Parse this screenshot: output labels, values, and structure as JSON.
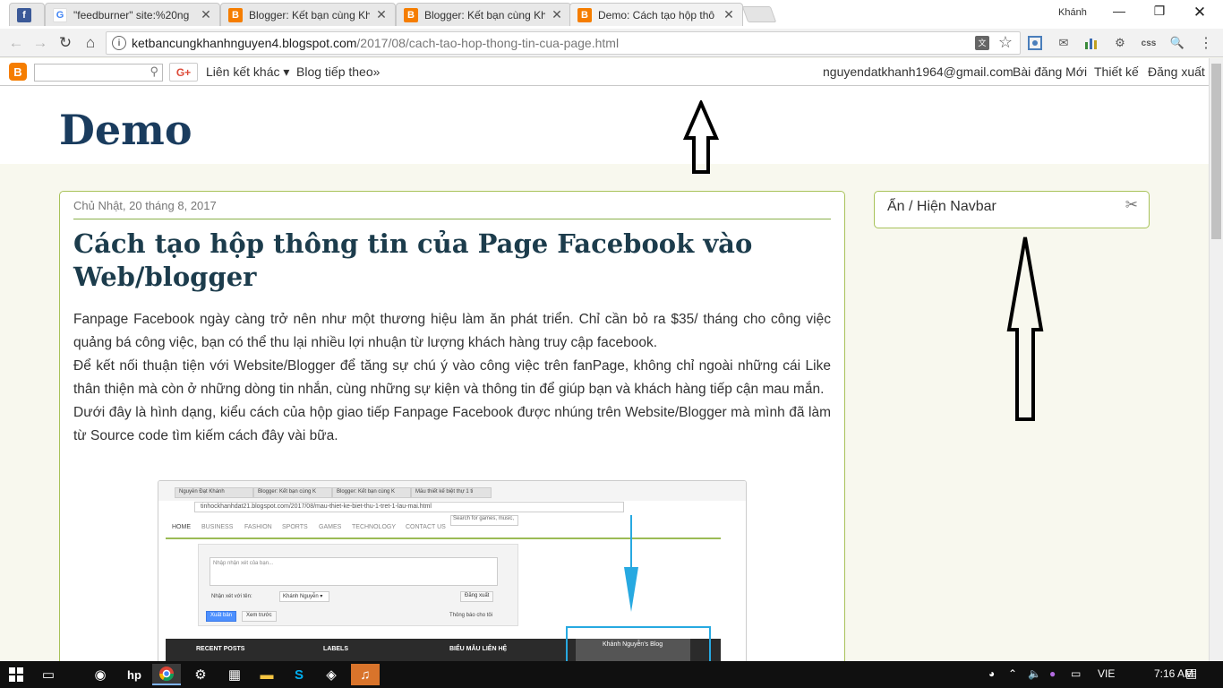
{
  "browser": {
    "tabs": [
      {
        "title": "",
        "favicon": "facebook-icon",
        "fav_color": "#3b5998",
        "active": false
      },
      {
        "title": "\"feedburner\" site:%20ng",
        "favicon": "google-icon",
        "fav_color": "#4285f4",
        "active": false
      },
      {
        "title": "Blogger: Kết bạn cùng Kh",
        "favicon": "blogger-icon",
        "fav_color": "#f57d00",
        "active": false
      },
      {
        "title": "Blogger: Kết bạn cùng Kh",
        "favicon": "blogger-icon",
        "fav_color": "#f57d00",
        "active": false
      },
      {
        "title": "Demo: Cách tạo hộp thô",
        "favicon": "blogger-icon",
        "fav_color": "#f57d00",
        "active": true
      }
    ],
    "user_label": "Khánh",
    "address": {
      "host": "ketbancungkhanhnguyen4.blogspot.com",
      "path": "/2017/08/cach-tao-hop-thong-tin-cua-page.html"
    }
  },
  "blogger_nav": {
    "google_plus": "G+",
    "more_links": "Liên kết khác ▾",
    "next_blog": "Blog tiếp theo»",
    "email": "nguyendatkhanh1964@gmail.com",
    "new_post": "Bài đăng Mới",
    "design": "Thiết kế",
    "sign_out": "Đăng xuất"
  },
  "blog": {
    "title": "Demo"
  },
  "post": {
    "date": "Chủ Nhật, 20 tháng 8, 2017",
    "title": "Cách tạo hộp thông tin của Page Facebook vào Web/blogger",
    "paragraphs": [
      "Fanpage Facebook  ngày càng trở nên như một thương hiệu làm ăn phát triển. Chỉ cần bỏ ra $35/ tháng cho công việc quảng bá công việc, bạn có thể thu lại nhiều lợi nhuận từ lượng khách hàng truy cập facebook.",
      "Để kết nối thuận tiện với Website/Blogger để tăng sự chú ý vào công việc trên fanPage, không chỉ ngoài những cái Like thân thiện mà còn ở những dòng tin nhắn, cùng những sự kiện và thông tin để giúp bạn và khách hàng tiếp cận mau mắn.",
      "Dưới đây là hình dạng, kiểu cách của hộp giao tiếp Fanpage Facebook được nhúng trên Website/Blogger mà mình đã làm từ Source code tìm kiếm cách đây vài bữa."
    ]
  },
  "embedded_screenshot": {
    "tabs": [
      "Nguyễn Đạt Khánh",
      "Blogger: Kết bạn cùng K",
      "Blogger: Kết bạn cùng K",
      "Mẫu thiết kế biệt thự 1 ti"
    ],
    "url": "tinhockhanhdat21.blogspot.com/2017/08/mau-thiet-ke-biet-thu-1-tret-1-lau-mai.html",
    "nav": [
      "HOME",
      "BUSINESS",
      "FASHION",
      "SPORTS",
      "GAMES",
      "TECHNOLOGY",
      "CONTACT US"
    ],
    "search_placeholder": "Search for games, music,",
    "comment_placeholder": "Nhập nhận xét của bạn...",
    "comment_as_label": "Nhận xét với tên:",
    "comment_as_value": "Khánh Nguyễn ▾",
    "sign_out": "Đăng xuất",
    "publish": "Xuất bản",
    "preview": "Xem trước",
    "notify": "Thông báo cho tôi",
    "footer_heads": [
      "RECENT POSTS",
      "LABELS",
      "BIỂU MẪU LIÊN HỆ"
    ],
    "fb_widget_title": "Khánh Nguyễn's Blog"
  },
  "sidebar": {
    "widget_title": "Ẩn / Hiện Navbar"
  },
  "taskbar": {
    "language": "VIE",
    "time": "7:16 AM"
  }
}
